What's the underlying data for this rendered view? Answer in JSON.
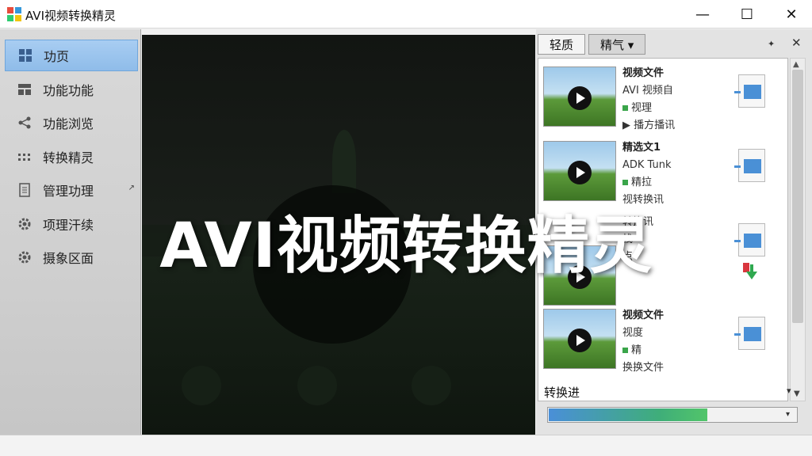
{
  "window": {
    "title": "AVI视频转换精灵",
    "minimize": "—",
    "maximize": "☐",
    "close": "✕"
  },
  "sidebar": {
    "items": [
      {
        "label": "功页",
        "icon": "grid-icon",
        "active": true
      },
      {
        "label": "功能功能",
        "icon": "layout-icon",
        "active": false
      },
      {
        "label": "功能浏览",
        "icon": "share-icon",
        "active": false
      },
      {
        "label": "转换精灵",
        "icon": "dots-icon",
        "active": false
      },
      {
        "label": "管理功理",
        "icon": "document-icon",
        "active": false,
        "arrow": "↗"
      },
      {
        "label": "项理汗续",
        "icon": "gear-icon",
        "active": false
      },
      {
        "label": "摄象区面",
        "icon": "gear-icon",
        "active": false
      }
    ]
  },
  "overlay": {
    "title": "AVI视频转换精灵"
  },
  "panel": {
    "tabs": [
      {
        "label": "轻质"
      },
      {
        "label": "精气 ▾"
      }
    ],
    "pin": "✦",
    "close": "✕",
    "items": [
      {
        "name": "视频文件",
        "line1": "AVI 视频自",
        "line2": "视理",
        "line3": "▶ 播方播讯"
      },
      {
        "name": "精选文1",
        "line1": "ADK Tunk",
        "line2": "精拉",
        "line3": "视转换讯"
      },
      {
        "name": "",
        "line1": "转换讯",
        "line2": "栈",
        "line3": "点"
      },
      {
        "name": "视频文件",
        "line1": "视度",
        "line2": "精",
        "line3": "换换文件"
      }
    ],
    "progress": {
      "label": "转换进",
      "caret": "▾",
      "value": 0.64
    },
    "scroll_up": "▲",
    "scroll_down": "▼"
  }
}
